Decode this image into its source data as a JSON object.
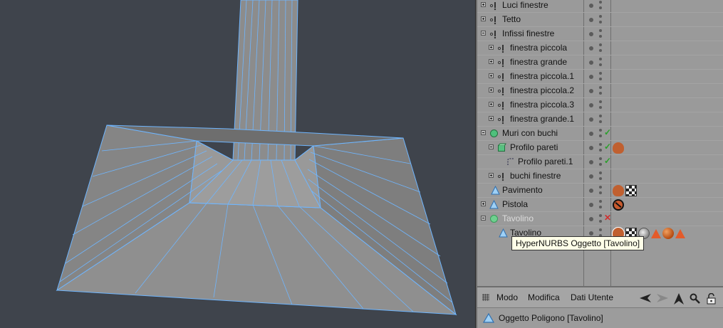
{
  "object_manager": {
    "rows": [
      {
        "label": "Luci finestre",
        "indent": 0,
        "toggle": "plus",
        "icon": "null-object-icon",
        "status": ""
      },
      {
        "label": "Tetto",
        "indent": 0,
        "toggle": "plus",
        "icon": "null-object-icon",
        "status": ""
      },
      {
        "label": "Infissi finestre",
        "indent": 0,
        "toggle": "minus",
        "icon": "null-object-icon",
        "status": ""
      },
      {
        "label": "finestra  piccola",
        "indent": 1,
        "toggle": "plus",
        "icon": "null-object-icon",
        "status": ""
      },
      {
        "label": "finestra grande",
        "indent": 1,
        "toggle": "plus",
        "icon": "null-object-icon",
        "status": ""
      },
      {
        "label": "finestra  piccola.1",
        "indent": 1,
        "toggle": "plus",
        "icon": "null-object-icon",
        "status": ""
      },
      {
        "label": "finestra  piccola.2",
        "indent": 1,
        "toggle": "plus",
        "icon": "null-object-icon",
        "status": ""
      },
      {
        "label": "finestra  piccola.3",
        "indent": 1,
        "toggle": "plus",
        "icon": "null-object-icon",
        "status": ""
      },
      {
        "label": "finestra grande.1",
        "indent": 1,
        "toggle": "plus",
        "icon": "null-object-icon",
        "status": ""
      },
      {
        "label": "Muri con buchi",
        "indent": 0,
        "toggle": "minus",
        "icon": "boole-icon",
        "status": "✓"
      },
      {
        "label": "Profilo pareti",
        "indent": 1,
        "toggle": "minus",
        "icon": "extrude-icon",
        "status": "✓",
        "tags": [
          "cloud"
        ]
      },
      {
        "label": "Profilo pareti.1",
        "indent": 2,
        "toggle": "none",
        "icon": "spline-icon",
        "status": "✓"
      },
      {
        "label": "buchi finestre",
        "indent": 1,
        "toggle": "plus",
        "icon": "null-object-icon",
        "status": ""
      },
      {
        "label": "Pavimento",
        "indent": 0,
        "toggle": "none",
        "icon": "polygon-icon",
        "status": "",
        "tags": [
          "cloud",
          "checker"
        ]
      },
      {
        "label": "Pistola",
        "indent": 0,
        "toggle": "plus",
        "icon": "polygon-icon",
        "status": "",
        "tags": [
          "forbidden"
        ]
      },
      {
        "label": "Tavolino",
        "indent": 0,
        "toggle": "minus",
        "icon": "hypernurbs-icon",
        "status": "✕",
        "grey": true
      },
      {
        "label": "Tavolino",
        "indent": 1,
        "toggle": "none",
        "icon": "polygon-icon",
        "status": "",
        "tags": [
          "cloud-selected",
          "checker",
          "phong",
          "triangle",
          "mat",
          "triangle"
        ]
      }
    ],
    "tooltip": "HyperNURBS Oggetto [Tavolino]"
  },
  "attributes": {
    "menus": [
      "Modo",
      "Modifica",
      "Dati Utente"
    ],
    "title": "Oggetto Poligono [Tavolino]"
  },
  "colors": {
    "wire": "#6fb6ff",
    "mesh": "#8a8a8a",
    "check": "#2aa02a",
    "cross": "#d03030"
  }
}
